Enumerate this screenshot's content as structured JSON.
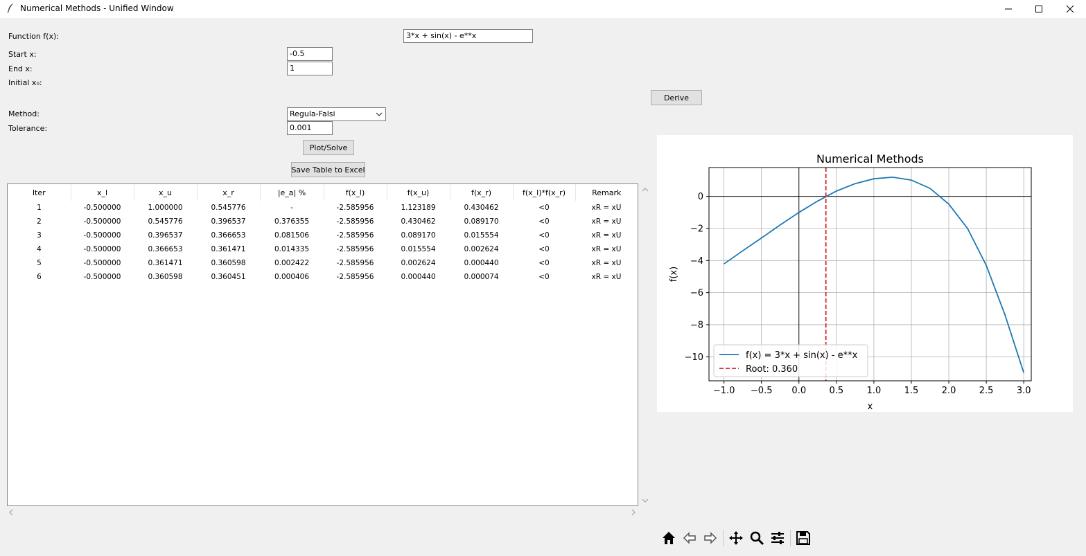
{
  "window": {
    "title": "Numerical Methods - Unified Window"
  },
  "form": {
    "function_label": "Function f(x):",
    "function_value": "3*x + sin(x) - e**x",
    "start_label": "Start x:",
    "start_value": "-0.5",
    "end_label": "End x:",
    "end_value": "1",
    "initial_label": "Initial x₀:",
    "derive_label": "Derive",
    "method_label": "Method:",
    "method_value": "Regula-Falsi",
    "tolerance_label": "Tolerance:",
    "tolerance_value": "0.001",
    "plot_label": "Plot/Solve",
    "save_label": "Save Table to Excel"
  },
  "table": {
    "headers": [
      "Iter",
      "x_l",
      "x_u",
      "x_r",
      "|e_a| %",
      "f(x_l)",
      "f(x_u)",
      "f(x_r)",
      "f(x_l)*f(x_r)",
      "Remark"
    ],
    "rows": [
      [
        "1",
        "-0.500000",
        "1.000000",
        "0.545776",
        "-",
        "-2.585956",
        "1.123189",
        "0.430462",
        "<0",
        "xR = xU"
      ],
      [
        "2",
        "-0.500000",
        "0.545776",
        "0.396537",
        "0.376355",
        "-2.585956",
        "0.430462",
        "0.089170",
        "<0",
        "xR = xU"
      ],
      [
        "3",
        "-0.500000",
        "0.396537",
        "0.366653",
        "0.081506",
        "-2.585956",
        "0.089170",
        "0.015554",
        "<0",
        "xR = xU"
      ],
      [
        "4",
        "-0.500000",
        "0.366653",
        "0.361471",
        "0.014335",
        "-2.585956",
        "0.015554",
        "0.002624",
        "<0",
        "xR = xU"
      ],
      [
        "5",
        "-0.500000",
        "0.361471",
        "0.360598",
        "0.002422",
        "-2.585956",
        "0.002624",
        "0.000440",
        "<0",
        "xR = xU"
      ],
      [
        "6",
        "-0.500000",
        "0.360598",
        "0.360451",
        "0.000406",
        "-2.585956",
        "0.000440",
        "0.000074",
        "<0",
        "xR = xU"
      ]
    ]
  },
  "toolbar": {
    "icons": [
      "home-icon",
      "back-icon",
      "forward-icon",
      "pan-icon",
      "zoom-icon",
      "configure-icon",
      "save-icon"
    ]
  },
  "chart_data": {
    "type": "line",
    "title": "Numerical Methods",
    "xlabel": "x",
    "ylabel": "f(x)",
    "xlim": [
      -1.2,
      3.1
    ],
    "ylim": [
      -11.5,
      1.8
    ],
    "xticks": [
      -1.0,
      -0.5,
      0.0,
      0.5,
      1.0,
      1.5,
      2.0,
      2.5,
      3.0
    ],
    "xtick_labels": [
      "−1.0",
      "−0.5",
      "0.0",
      "0.5",
      "1.0",
      "1.5",
      "2.0",
      "2.5",
      "3.0"
    ],
    "yticks": [
      0,
      -2,
      -4,
      -6,
      -8,
      -10
    ],
    "ytick_labels": [
      "0",
      "−2",
      "−4",
      "−6",
      "−8",
      "−10"
    ],
    "grid": true,
    "legend_position": "lower-left",
    "series": [
      {
        "name": "f(x) = 3*x + sin(x) - e**x",
        "color": "#1f77b4",
        "x": [
          -1.0,
          -0.75,
          -0.5,
          -0.25,
          0.0,
          0.25,
          0.5,
          0.75,
          1.0,
          1.25,
          1.5,
          1.75,
          2.0,
          2.25,
          2.5,
          2.75,
          3.0
        ],
        "y": [
          -4.21,
          -3.39,
          -2.59,
          -1.78,
          -1.0,
          -0.29,
          0.33,
          0.8,
          1.1,
          1.2,
          1.02,
          0.5,
          -0.48,
          -2.0,
          -4.3,
          -7.4,
          -11.0
        ]
      }
    ],
    "root": {
      "name": "Root: 0.360",
      "x": 0.36,
      "color": "#d62728"
    }
  }
}
